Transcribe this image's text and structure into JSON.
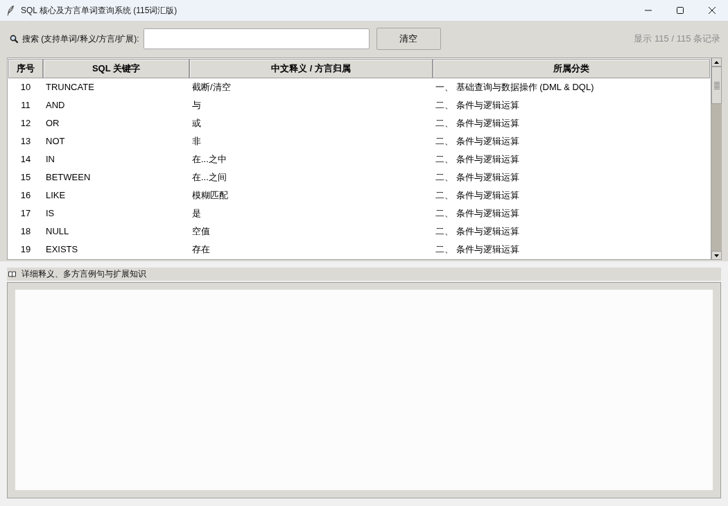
{
  "window": {
    "title": "SQL 核心及方言单词查询系统 (115词汇版)"
  },
  "search": {
    "label": "搜索 (支持单词/释义/方言/扩展):",
    "clear_button": "清空",
    "record_count": "显示 115 / 115 条记录"
  },
  "table": {
    "columns": [
      "序号",
      "SQL 关键字",
      "中文释义 / 方言归属",
      "所属分类"
    ],
    "rows": [
      {
        "cells": [
          "10",
          "TRUNCATE",
          "截断/清空",
          "一、 基础查询与数据操作 (DML & DQL)"
        ],
        "selected": false
      },
      {
        "cells": [
          "11",
          "AND",
          "与",
          "二、 条件与逻辑运算"
        ],
        "selected": false
      },
      {
        "cells": [
          "12",
          "OR",
          "或",
          "二、 条件与逻辑运算"
        ],
        "selected": false
      },
      {
        "cells": [
          "13",
          "NOT",
          "非",
          "二、 条件与逻辑运算"
        ],
        "selected": false
      },
      {
        "cells": [
          "14",
          "IN",
          "在...之中",
          "二、 条件与逻辑运算"
        ],
        "selected": false
      },
      {
        "cells": [
          "15",
          "BETWEEN",
          "在...之间",
          "二、 条件与逻辑运算"
        ],
        "selected": false
      },
      {
        "cells": [
          "16",
          "LIKE",
          "模糊匹配",
          "二、 条件与逻辑运算"
        ],
        "selected": false
      },
      {
        "cells": [
          "17",
          "IS",
          "是",
          "二、 条件与逻辑运算"
        ],
        "selected": false
      },
      {
        "cells": [
          "18",
          "NULL",
          "空值",
          "二、 条件与逻辑运算"
        ],
        "selected": false
      },
      {
        "cells": [
          "19",
          "EXISTS",
          "存在",
          "二、 条件与逻辑运算"
        ],
        "selected": false
      }
    ]
  },
  "details": {
    "title": "详细释义、多方言例句与扩展知识"
  }
}
